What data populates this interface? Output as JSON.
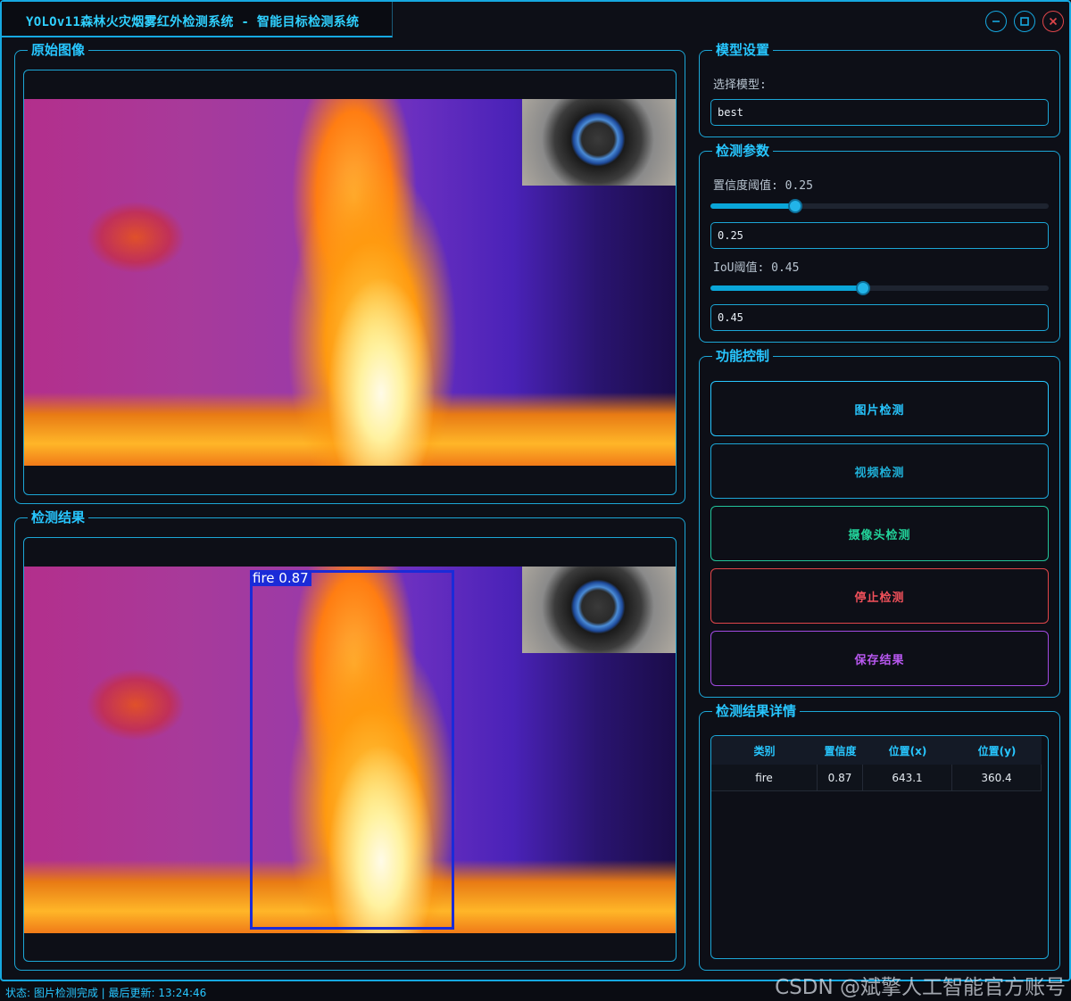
{
  "window": {
    "title": "YOLOv11森林火灾烟雾红外检测系统 - 智能目标检测系统"
  },
  "panels": {
    "original": "原始图像",
    "result": "检测结果",
    "model": "模型设置",
    "params": "检测参数",
    "functions": "功能控制",
    "details": "检测结果详情"
  },
  "model": {
    "select_label": "选择模型:",
    "selected": "best"
  },
  "params": {
    "conf_label": "置信度阈值: 0.25",
    "conf_value": "0.25",
    "conf_level": 0.25,
    "iou_label": "IoU阈值: 0.45",
    "iou_value": "0.45",
    "iou_level": 0.45
  },
  "buttons": {
    "image": "图片检测",
    "video": "视频检测",
    "camera": "摄像头检测",
    "stop": "停止检测",
    "save": "保存结果"
  },
  "detection_overlay": {
    "label": "fire 0.87"
  },
  "results_table": {
    "headers": [
      "类别",
      "置信度",
      "位置(x)",
      "位置(y)"
    ],
    "rows": [
      [
        "fire",
        "0.87",
        "643.1",
        "360.4"
      ]
    ]
  },
  "status": "状态: 图片检测完成 | 最后更新: 13:24:46",
  "watermark": "CSDN @斌擎人工智能官方账号",
  "colors": {
    "accent": "#1ca6d6",
    "image_btn": "#27c6ff",
    "camera_btn": "#22d39a",
    "stop_btn": "#e0464a",
    "save_btn": "#b04ee8",
    "bbox": "#1a2bd8"
  },
  "icons": [
    "minimize-icon",
    "maximize-icon",
    "close-icon"
  ]
}
